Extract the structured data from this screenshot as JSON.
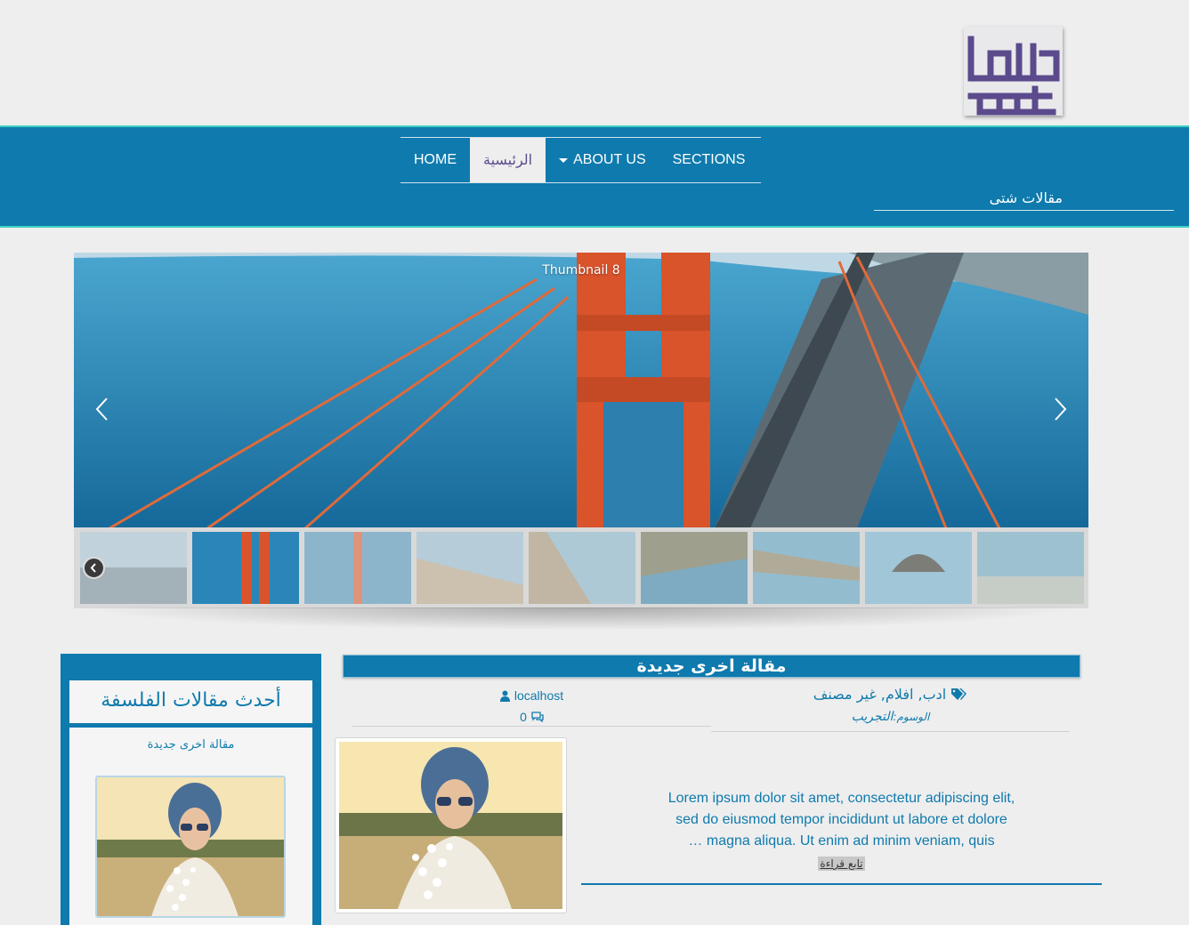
{
  "brand": {
    "logo_text": "مقال ستور",
    "logo_color": "#5b4a8c"
  },
  "theme": {
    "primary": "#0f7aad",
    "accent": "#3fd2c1"
  },
  "nav": {
    "items": [
      {
        "label": "Home"
      },
      {
        "label": "الرئيسية",
        "active": true
      },
      {
        "label": "About Us",
        "has_dropdown": true
      },
      {
        "label": "Sections"
      }
    ],
    "site_description": "مقالات شتى"
  },
  "slider": {
    "caption": "Thumbnail 8",
    "prev_icon": "chevron-left-icon",
    "next_icon": "chevron-right-icon",
    "thumbnail_count": 9,
    "active_thumbnail": 2
  },
  "sidebar": {
    "widget_title": "أحدث مقالات الفلسفة",
    "recent_post_link": "مقالة اخرى جديدة"
  },
  "post": {
    "title": "مقالة اخرى جديدة",
    "author": "localhost",
    "comments": "0",
    "categories": "ادب, افلام, غير مصنف",
    "tags_label": "الوسوم:",
    "tag": "التجريب",
    "excerpt_lines": [
      "Lorem ipsum dolor sit amet, consectetur adipiscing elit,",
      "sed do eiusmod tempor incididunt ut labore et dolore",
      "… magna aliqua. Ut enim ad minim veniam, quis"
    ],
    "read_more": "تابع قراءة"
  }
}
